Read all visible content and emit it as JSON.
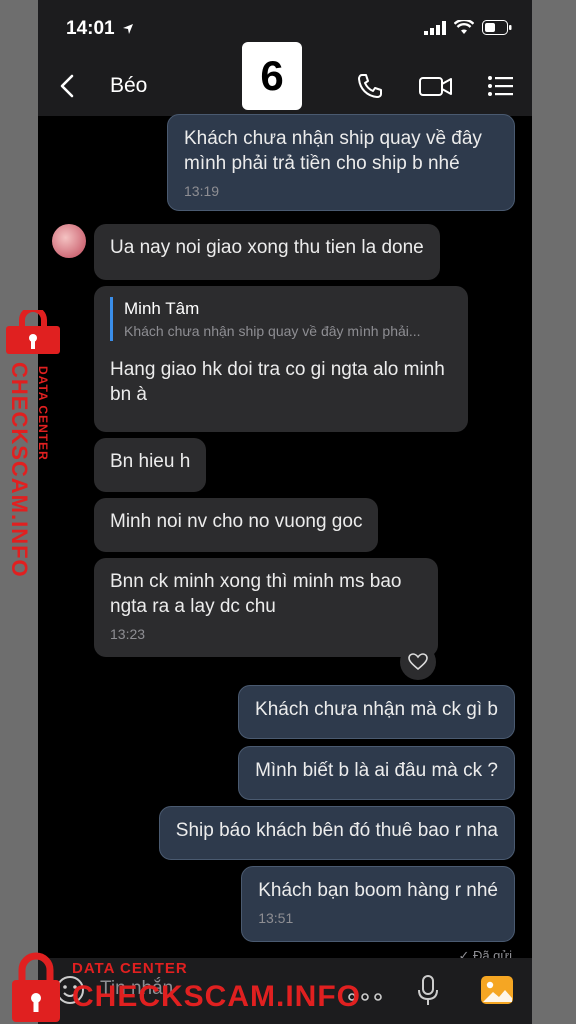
{
  "status_bar": {
    "time": "14:01"
  },
  "header": {
    "contact_name": "Béo",
    "badge": "6"
  },
  "messages": [
    {
      "text": "Khách chưa nhận ship quay về đây mình phải trả tiền cho ship b nhé",
      "time": "13:19"
    },
    {
      "text": "Ua nay noi giao xong  thu tien la done"
    },
    {
      "quote_name": "Minh Tâm",
      "quote_text": "Khách chưa nhận ship quay về đây mình phải...",
      "text": "Hang giao hk doi tra co gi ngta alo minh bn à"
    },
    {
      "text": "Bn hieu h"
    },
    {
      "text": "Minh noi nv cho no vuong goc"
    },
    {
      "text": "Bnn ck minh xong thì minh ms bao ngta ra a lay dc chu",
      "time": "13:23"
    },
    {
      "text": "Khách chưa nhận mà ck gì b"
    },
    {
      "text": "Mình biết b là ai đâu mà ck ?"
    },
    {
      "text": "Ship báo khách bên đó thuê bao r nha"
    },
    {
      "text": "Khách bạn boom hàng r nhé",
      "time": "13:51"
    }
  ],
  "sent_status": "✓ Đã gửi",
  "input": {
    "placeholder": "Tin nhắn"
  },
  "watermark": {
    "main": "CHECKSCAM.INFO",
    "sub": "DATA CENTER"
  },
  "colors": {
    "accent": "#3a8eea",
    "watermark": "#e02020",
    "outgoing_bubble": "#2e3a4c",
    "incoming_bubble": "#2c2c2e"
  }
}
